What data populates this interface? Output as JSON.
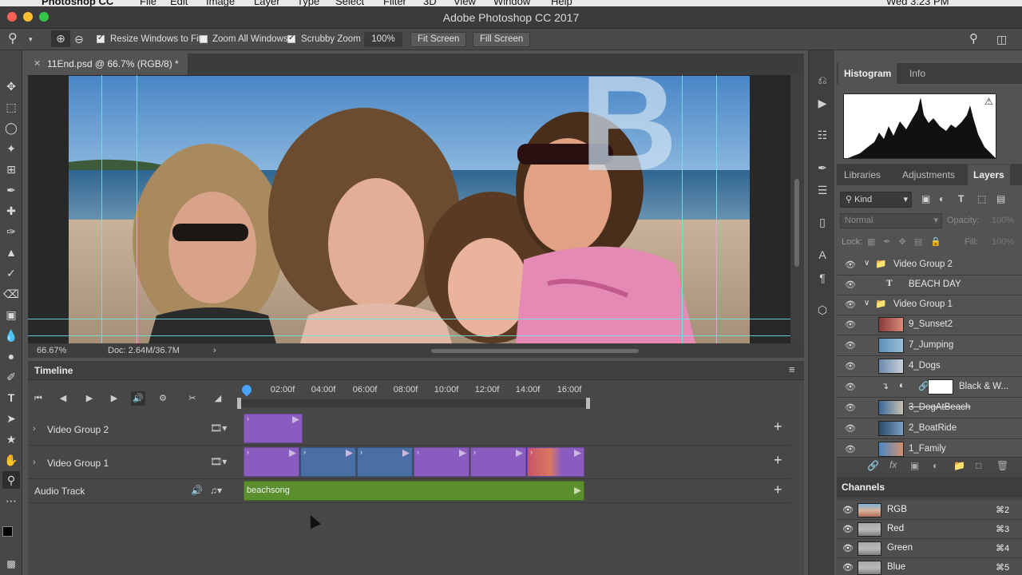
{
  "menubar": {
    "items": [
      "Photoshop CC",
      "File",
      "Edit",
      "Image",
      "Layer",
      "Type",
      "Select",
      "Filter",
      "3D",
      "View",
      "Window",
      "Help"
    ],
    "clock": "Wed 3:23 PM"
  },
  "window": {
    "title": "Adobe Photoshop CC 2017"
  },
  "options_bar": {
    "resize_windows_label": "Resize Windows to Fit",
    "zoom_all_label": "Zoom All Windows",
    "scrubby_zoom_label": "Scrubby Zoom",
    "zoom_value": "100%",
    "fit_screen": "Fit Screen",
    "fill_screen": "Fill Screen"
  },
  "document": {
    "tab_title": "11End.psd @ 66.7% (RGB/8) *",
    "zoom_status": "66.67%",
    "doc_size": "Doc: 2.64M/36.7M",
    "overlay_letter": "B"
  },
  "timeline": {
    "title": "Timeline",
    "ruler": [
      "02:00f",
      "04:00f",
      "06:00f",
      "08:00f",
      "10:00f",
      "12:00f",
      "14:00f",
      "16:00f"
    ],
    "tracks": [
      {
        "name": "Video Group 2"
      },
      {
        "name": "Video Group 1"
      },
      {
        "name": "Audio Track",
        "clip": "beachsong"
      }
    ]
  },
  "histogram_panel": {
    "tabs": [
      "Histogram",
      "Info"
    ]
  },
  "layers_panel": {
    "tabs": [
      "Libraries",
      "Adjustments",
      "Layers"
    ],
    "kind": "Kind",
    "blend_mode": "Normal",
    "opacity_label": "Opacity:",
    "opacity_value": "100%",
    "lock_label": "Lock:",
    "fill_label": "Fill:",
    "fill_value": "100%",
    "layers": [
      {
        "name": "Video Group 2",
        "kind": "group"
      },
      {
        "name": "BEACH DAY",
        "kind": "text"
      },
      {
        "name": "Video Group 1",
        "kind": "group"
      },
      {
        "name": "9_Sunset2",
        "kind": "video"
      },
      {
        "name": "7_Jumping",
        "kind": "video"
      },
      {
        "name": "4_Dogs",
        "kind": "video"
      },
      {
        "name": "Black & W...",
        "kind": "adjustment"
      },
      {
        "name": "3_DogAtBeach",
        "kind": "video"
      },
      {
        "name": "2_BoatRide",
        "kind": "video"
      },
      {
        "name": "1_Family",
        "kind": "video"
      }
    ]
  },
  "channels_panel": {
    "title": "Channels",
    "channels": [
      {
        "name": "RGB",
        "key": "⌘2"
      },
      {
        "name": "Red",
        "key": "⌘3"
      },
      {
        "name": "Green",
        "key": "⌘4"
      },
      {
        "name": "Blue",
        "key": "⌘5"
      }
    ]
  },
  "colors": {
    "accent_purple": "#8b5cc0",
    "clip_blue": "#4a6fa5",
    "audio_green": "#5b8f2e",
    "guide_cyan": "#6fe4e8"
  }
}
